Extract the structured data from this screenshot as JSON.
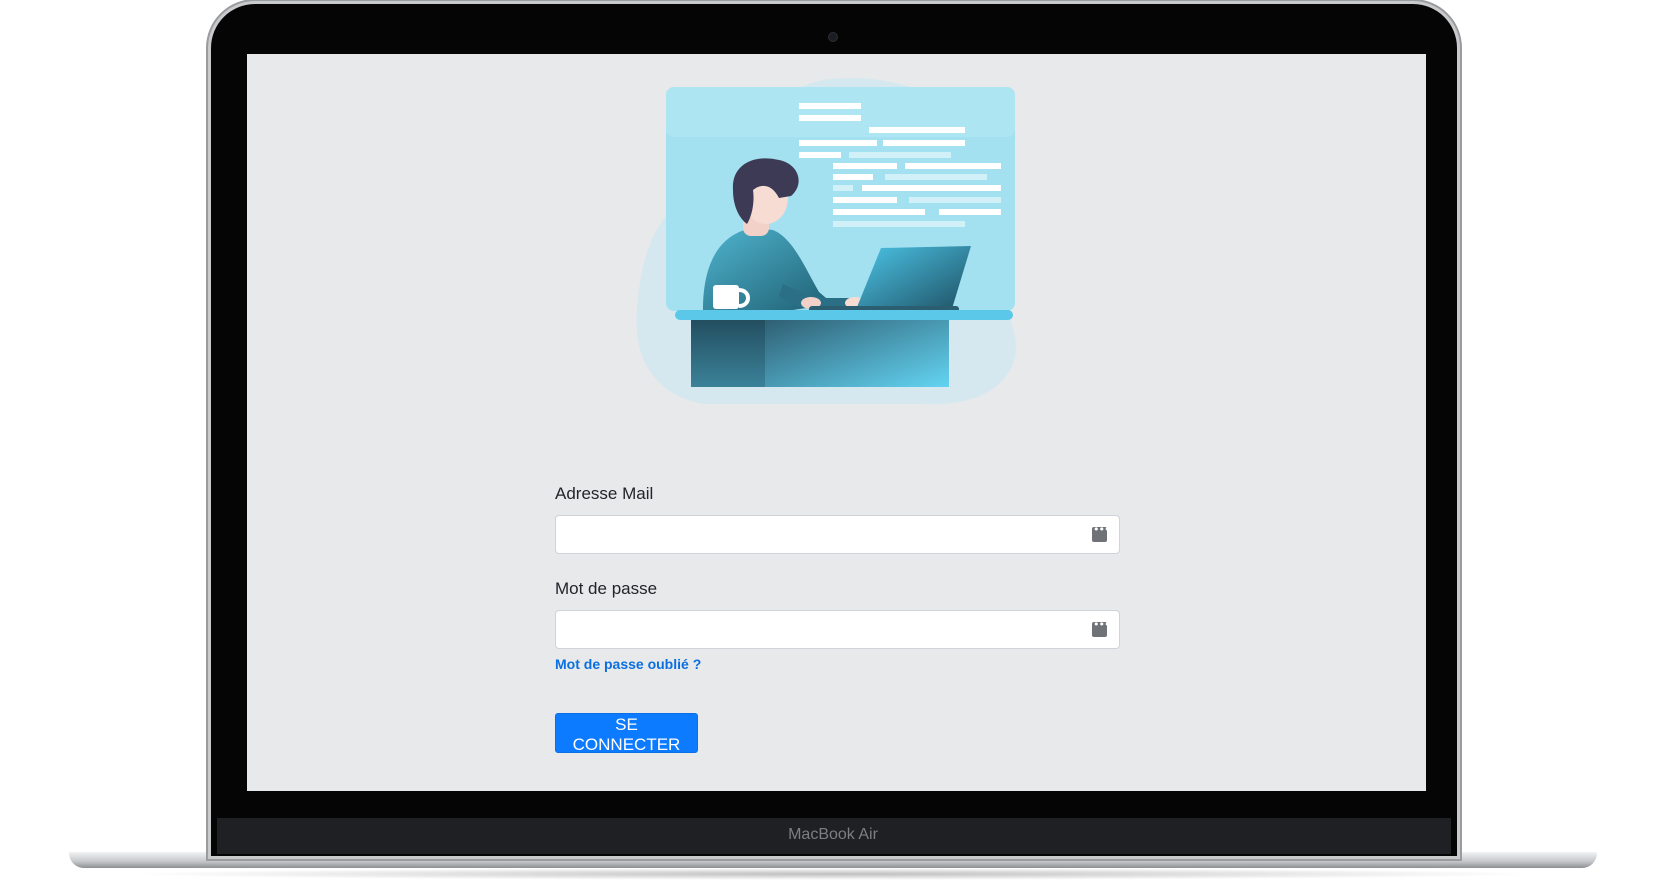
{
  "device": {
    "label": "MacBook Air"
  },
  "login": {
    "email_label": "Adresse Mail",
    "email_value": "",
    "password_label": "Mot de passe",
    "password_value": "",
    "forgot_link": "Mot de passe oublié ?",
    "submit_label": "SE CONNECTER"
  },
  "illustration": {
    "subject": "person-working-at-laptop-illustration"
  },
  "icons": {
    "field_icon": "password-manager-icon"
  },
  "colors": {
    "screen_background": "#e8e9eb",
    "primary_button": "#0d7bff",
    "link": "#0a6fe0",
    "illustration_panel": "#a3e1f1",
    "illustration_desk": "#5bc8ea"
  }
}
